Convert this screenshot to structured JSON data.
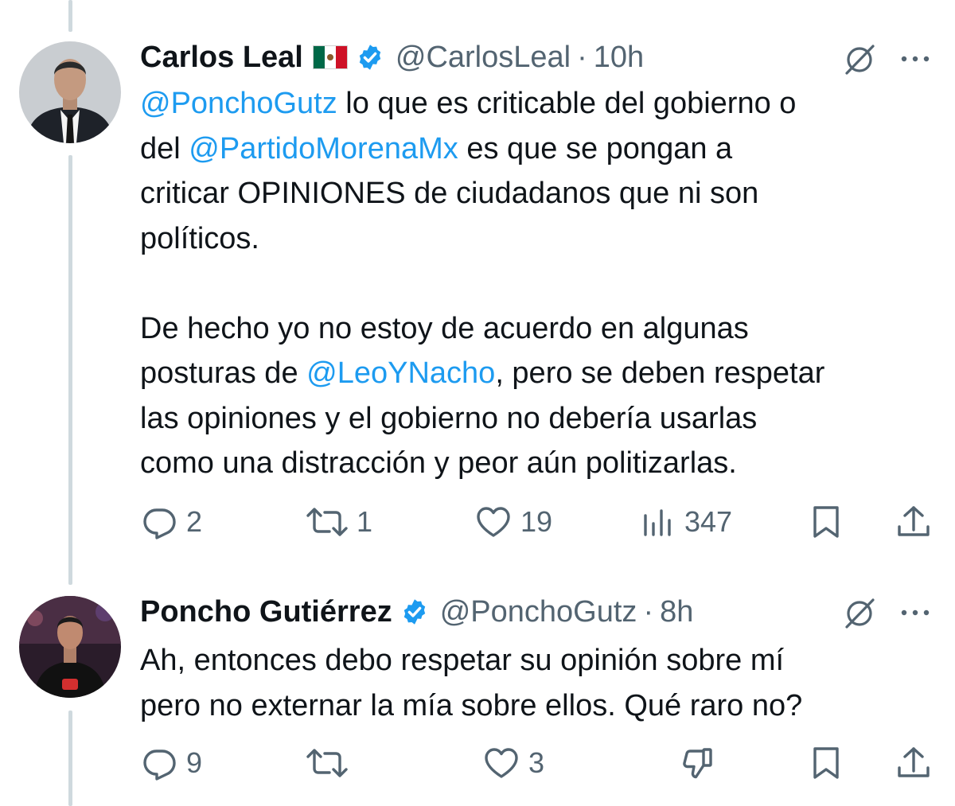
{
  "tweets": [
    {
      "author": {
        "name": "Carlos Leal",
        "flag_emoji": "🇲🇽",
        "verified": true,
        "handle": "@CarlosLeal",
        "time": "10h"
      },
      "text": {
        "m1": "@PonchoGutz",
        "t1": " lo que es criticable del gobierno o\ndel ",
        "m2": "@PartidoMorenaMx",
        "t2": " es que se pongan a\ncriticar OPINIONES de ciudadanos que ni son\npolíticos.\n\nDe hecho yo no estoy de acuerdo en algunas\nposturas de ",
        "m3": "@LeoYNacho",
        "t3": ", pero se deben respetar\nlas opiniones y el gobierno no debería usarlas\ncomo una distracción y peor aún politizarlas."
      },
      "stats": {
        "replies": "2",
        "reposts": "1",
        "likes": "19",
        "views": "347"
      }
    },
    {
      "author": {
        "name": "Poncho Gutiérrez",
        "verified": true,
        "handle": "@PonchoGutz",
        "time": "8h"
      },
      "text": {
        "t1": "Ah, entonces debo respetar su opinión sobre mí\npero no externar la mía sobre ellos. Qué raro no?"
      },
      "stats": {
        "replies": "9",
        "reposts": "",
        "likes": "3"
      }
    }
  ],
  "icons": {
    "reply": "reply-icon",
    "repost": "repost-icon",
    "like": "heart-icon",
    "views": "views-icon",
    "bookmark": "bookmark-icon",
    "share": "share-icon",
    "grok": "grok-icon",
    "more": "more-icon",
    "verified": "verified-badge-icon",
    "downvote": "downvote-icon"
  },
  "colors": {
    "link": "#1d9bf0",
    "muted": "#536471",
    "text": "#0f1419",
    "thread_line": "#cfd9de"
  }
}
